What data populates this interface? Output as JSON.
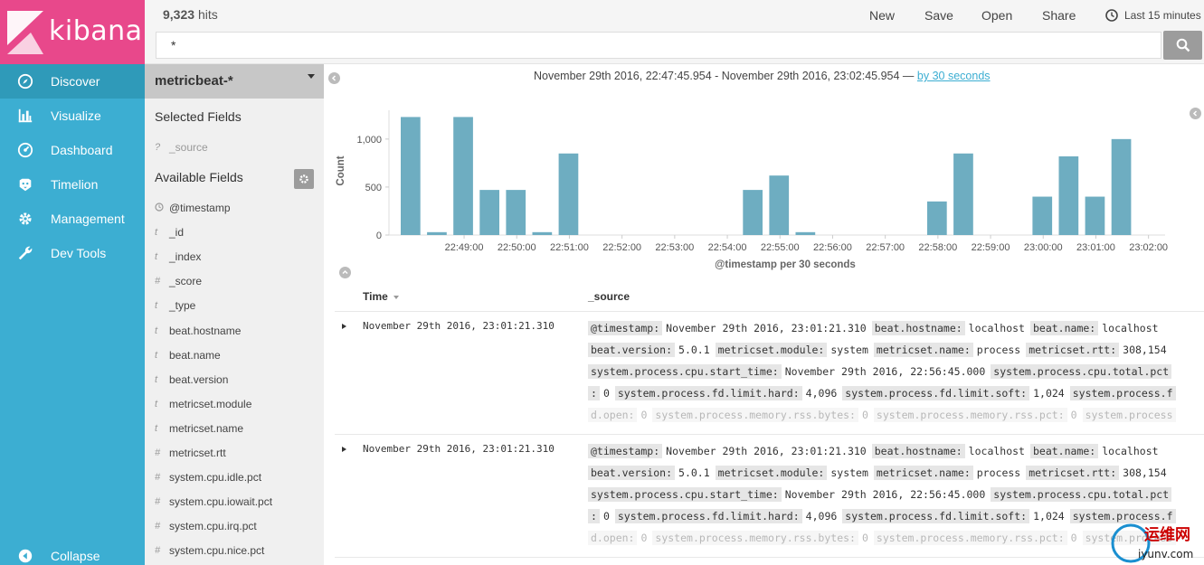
{
  "app": {
    "brand": "kibana"
  },
  "nav": {
    "items": [
      {
        "label": "Discover",
        "icon": "compass-icon"
      },
      {
        "label": "Visualize",
        "icon": "bar-chart-icon"
      },
      {
        "label": "Dashboard",
        "icon": "dashboard-icon"
      },
      {
        "label": "Timelion",
        "icon": "timelion-icon"
      },
      {
        "label": "Management",
        "icon": "gear-icon"
      },
      {
        "label": "Dev Tools",
        "icon": "wrench-icon"
      }
    ],
    "collapse": "Collapse"
  },
  "topbar": {
    "hits_count": "9,323",
    "hits_label": "hits",
    "menu": [
      "New",
      "Save",
      "Open",
      "Share"
    ],
    "time_range": "Last 15 minutes",
    "query": "*"
  },
  "sidebar": {
    "index_pattern": "metricbeat-*",
    "selected_title": "Selected Fields",
    "selected_fields": [
      {
        "type": "?",
        "name": "_source"
      }
    ],
    "available_title": "Available Fields",
    "available_fields": [
      {
        "type": "clock",
        "name": "@timestamp"
      },
      {
        "type": "t",
        "name": "_id"
      },
      {
        "type": "t",
        "name": "_index"
      },
      {
        "type": "#",
        "name": "_score"
      },
      {
        "type": "t",
        "name": "_type"
      },
      {
        "type": "t",
        "name": "beat.hostname"
      },
      {
        "type": "t",
        "name": "beat.name"
      },
      {
        "type": "t",
        "name": "beat.version"
      },
      {
        "type": "t",
        "name": "metricset.module"
      },
      {
        "type": "t",
        "name": "metricset.name"
      },
      {
        "type": "#",
        "name": "metricset.rtt"
      },
      {
        "type": "#",
        "name": "system.cpu.idle.pct"
      },
      {
        "type": "#",
        "name": "system.cpu.iowait.pct"
      },
      {
        "type": "#",
        "name": "system.cpu.irq.pct"
      },
      {
        "type": "#",
        "name": "system.cpu.nice.pct"
      }
    ]
  },
  "main": {
    "range_text": "November 29th 2016, 22:47:45.954 - November 29th 2016, 23:02:45.954 —",
    "interval_link": "by 30 seconds",
    "col_time": "Time",
    "col_source": "_source"
  },
  "chart_data": {
    "type": "bar",
    "xlabel": "@timestamp per 30 seconds",
    "ylabel": "Count",
    "ylim": [
      0,
      1300
    ],
    "yticks": [
      "0",
      "500",
      "1,000"
    ],
    "xticks": [
      "22:49:00",
      "22:50:00",
      "22:51:00",
      "22:52:00",
      "22:53:00",
      "22:54:00",
      "22:55:00",
      "22:56:00",
      "22:57:00",
      "22:58:00",
      "22:59:00",
      "23:00:00",
      "23:01:00",
      "23:02:00"
    ],
    "x": [
      "22:48:00",
      "22:48:30",
      "22:49:00",
      "22:49:30",
      "22:50:00",
      "22:50:30",
      "22:51:00",
      "22:51:30",
      "22:52:00",
      "22:52:30",
      "22:53:00",
      "22:53:30",
      "22:54:00",
      "22:54:30",
      "22:55:00",
      "22:55:30",
      "22:56:00",
      "22:56:30",
      "22:57:00",
      "22:57:30",
      "22:58:00",
      "22:58:30",
      "22:59:00",
      "22:59:30",
      "23:00:00",
      "23:00:30",
      "23:01:00",
      "23:01:30",
      "23:02:00"
    ],
    "values": [
      1230,
      30,
      1230,
      470,
      470,
      30,
      850,
      0,
      0,
      0,
      0,
      0,
      0,
      470,
      620,
      30,
      0,
      0,
      0,
      0,
      350,
      850,
      0,
      0,
      400,
      820,
      400,
      1000,
      0
    ],
    "color": "#6eadc1"
  },
  "documents": [
    {
      "time": "November 29th 2016, 23:01:21.310",
      "lines": [
        [
          [
            "@timestamp:",
            "November 29th 2016, 23:01:21.310"
          ],
          [
            "beat.hostname:",
            "localhost"
          ],
          [
            "beat.name:",
            "localhost"
          ]
        ],
        [
          [
            "beat.version:",
            "5.0.1"
          ],
          [
            "metricset.module:",
            "system"
          ],
          [
            "metricset.name:",
            "process"
          ],
          [
            "metricset.rtt:",
            "308,154"
          ]
        ],
        [
          [
            "system.process.cpu.start_time:",
            "November 29th 2016, 22:56:45.000"
          ],
          [
            "system.process.cpu.total.pct",
            ""
          ]
        ],
        [
          [
            ":",
            "0"
          ],
          [
            "system.process.fd.limit.hard:",
            "4,096"
          ],
          [
            "system.process.fd.limit.soft:",
            "1,024"
          ],
          [
            "system.process.f",
            ""
          ]
        ],
        [
          [
            "d.open:",
            "0"
          ],
          [
            "system.process.memory.rss.bytes:",
            "0"
          ],
          [
            "system.process.memory.rss.pct:",
            "0"
          ],
          [
            "system.process",
            ""
          ]
        ]
      ]
    },
    {
      "time": "November 29th 2016, 23:01:21.310",
      "lines": [
        [
          [
            "@timestamp:",
            "November 29th 2016, 23:01:21.310"
          ],
          [
            "beat.hostname:",
            "localhost"
          ],
          [
            "beat.name:",
            "localhost"
          ]
        ],
        [
          [
            "beat.version:",
            "5.0.1"
          ],
          [
            "metricset.module:",
            "system"
          ],
          [
            "metricset.name:",
            "process"
          ],
          [
            "metricset.rtt:",
            "308,154"
          ]
        ],
        [
          [
            "system.process.cpu.start_time:",
            "November 29th 2016, 22:56:45.000"
          ],
          [
            "system.process.cpu.total.pct",
            ""
          ]
        ],
        [
          [
            ":",
            "0"
          ],
          [
            "system.process.fd.limit.hard:",
            "4,096"
          ],
          [
            "system.process.fd.limit.soft:",
            "1,024"
          ],
          [
            "system.process.f",
            ""
          ]
        ],
        [
          [
            "d.open:",
            "0"
          ],
          [
            "system.process.memory.rss.bytes:",
            "0"
          ],
          [
            "system.process.memory.rss.pct:",
            "0"
          ],
          [
            "system.process",
            ""
          ]
        ]
      ]
    }
  ],
  "watermark": {
    "text": "运维网",
    "subtext": "iyunv.com"
  }
}
